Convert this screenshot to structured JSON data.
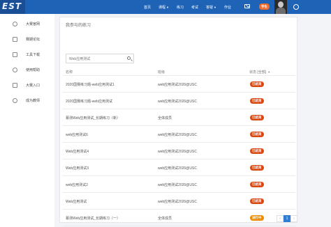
{
  "logo": {
    "text": "EST"
  },
  "nav": {
    "items": [
      {
        "label": "首页"
      },
      {
        "label": "课程",
        "dropdown": true
      },
      {
        "label": "练习"
      },
      {
        "label": "考试"
      },
      {
        "label": "答疑",
        "dropdown": true
      },
      {
        "label": "作业"
      }
    ],
    "user_badge": "学生",
    "colors": {
      "bar": "#1f63b6",
      "badge": "#f06a2a"
    }
  },
  "sidebar": {
    "items": [
      {
        "label": "大赛官网",
        "icon": "globe-icon"
      },
      {
        "label": "赛期论坛",
        "icon": "forum-icon"
      },
      {
        "label": "工具下载",
        "icon": "download-icon"
      },
      {
        "label": "使用帮助",
        "icon": "help-icon"
      },
      {
        "label": "大赛入口",
        "icon": "entry-icon"
      },
      {
        "label": "成为教师",
        "icon": "teacher-icon"
      }
    ]
  },
  "main": {
    "title": "我参与的练习",
    "search": {
      "placeholder": "Web应用测试",
      "value": ""
    },
    "columns": {
      "name": "名称",
      "class": "班级",
      "status": "状态",
      "status_filter": "[全部]"
    },
    "rows": [
      {
        "name": "2020国赛练习题-web应用测试1",
        "class": "web应用测试2020@USC",
        "status": "已结束",
        "status_color": "#d9480f"
      },
      {
        "name": "2020国赛练习题-web应用测试",
        "class": "web应用测试2020@USC",
        "status": "已结束",
        "status_color": "#d9480f"
      },
      {
        "name": "慕测Web应用测试_长期练习（新）",
        "class": "全体成员",
        "status": "已结束",
        "status_color": "#d9480f"
      },
      {
        "name": "web应用测试6",
        "class": "web应用测试2020@USC",
        "status": "已结束",
        "status_color": "#d9480f"
      },
      {
        "name": "Web应用测试4",
        "class": "web应用测试2020@USC",
        "status": "已结束",
        "status_color": "#d9480f"
      },
      {
        "name": "Web应用测试3",
        "class": "web应用测试2020@USC",
        "status": "已结束",
        "status_color": "#d9480f"
      },
      {
        "name": "web应用测试2",
        "class": "web应用测试2020@USC",
        "status": "已结束",
        "status_color": "#d9480f"
      },
      {
        "name": "Web应用测试",
        "class": "web应用测试2020@USC",
        "status": "已结束",
        "status_color": "#d9480f"
      },
      {
        "name": "慕测Web应用测试_长期练习（一）",
        "class": "全体成员",
        "status": "进行中",
        "status_color": "#f08c00"
      }
    ],
    "pagination": {
      "prev": "‹",
      "current": "1",
      "next": "›"
    }
  }
}
